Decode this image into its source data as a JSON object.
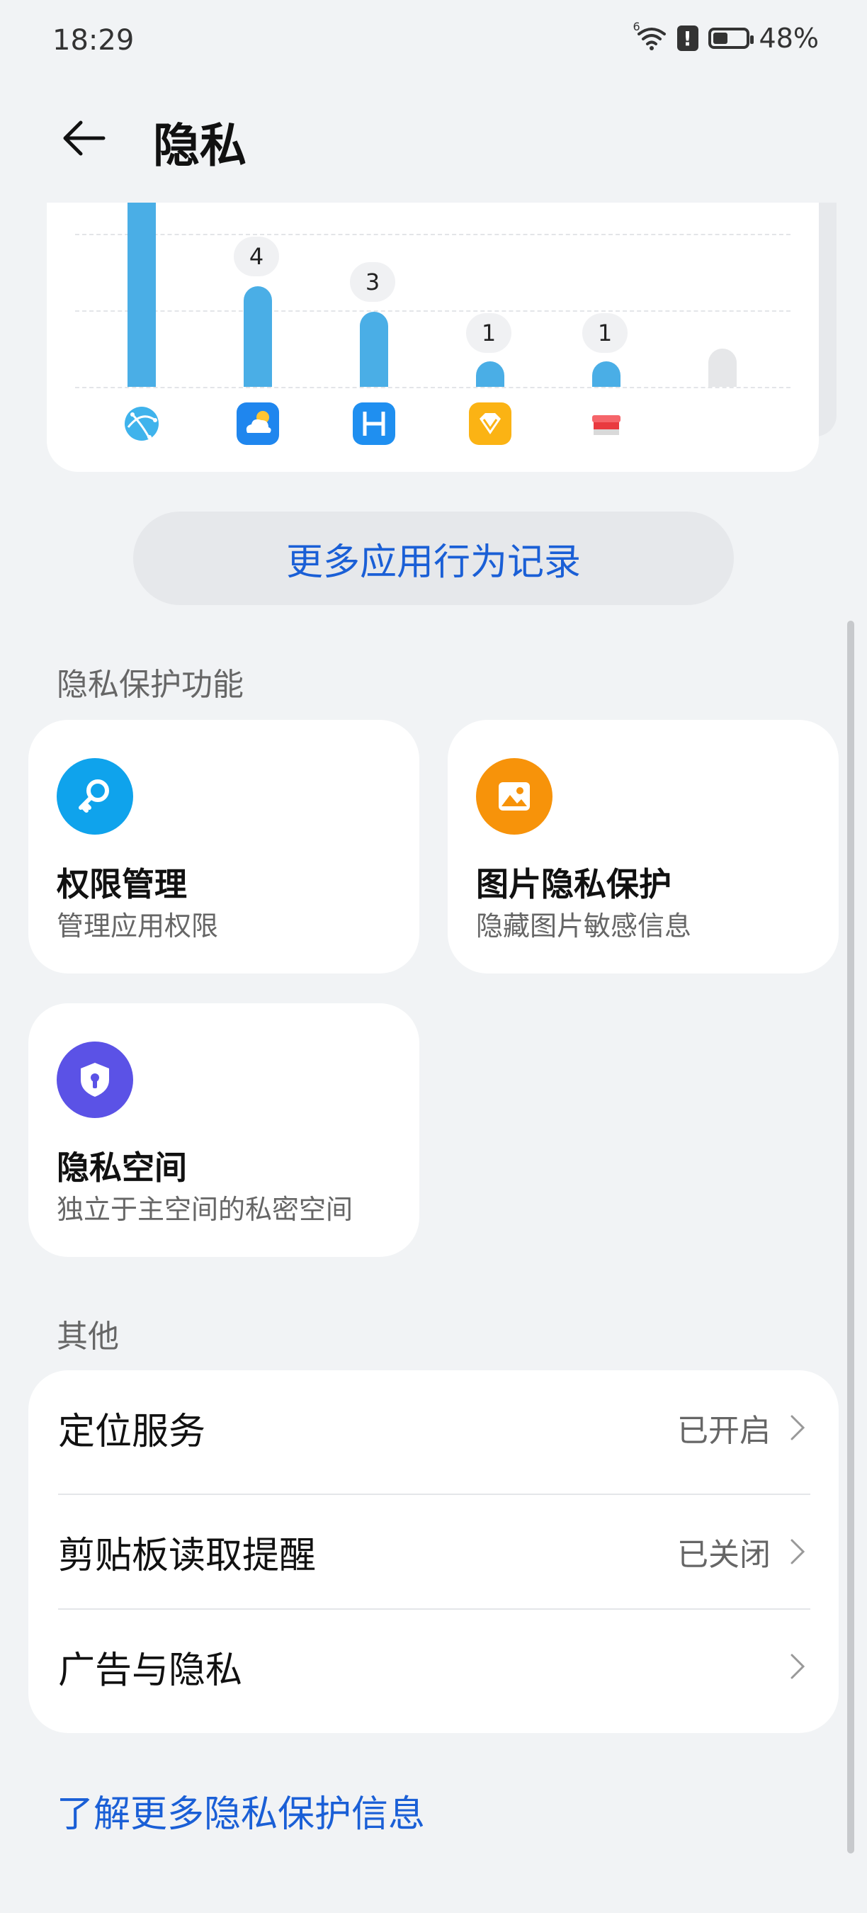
{
  "status_bar": {
    "time": "18:29",
    "battery": "48%",
    "signal_tag": "6"
  },
  "header": {
    "title": "隐私",
    "back_icon": "arrow-left-icon"
  },
  "chart_data": {
    "type": "bar",
    "categories": [
      "browser",
      "weather",
      "app-h",
      "diamond-app",
      "gift-app",
      "empty"
    ],
    "values": [
      null,
      4,
      3,
      1,
      1,
      0
    ],
    "labels": [
      "",
      "4",
      "3",
      "1",
      "1",
      ""
    ],
    "icons": [
      "globe-icon",
      "weather-icon",
      "h-app-icon",
      "diamond-icon",
      "gift-box-icon",
      ""
    ]
  },
  "more_button": {
    "label": "更多应用行为记录"
  },
  "privacy_section": {
    "label": "隐私保护功能",
    "cards": [
      {
        "title": "权限管理",
        "subtitle": "管理应用权限",
        "icon": "key-icon",
        "color": "#0fa3ec"
      },
      {
        "title": "图片隐私保护",
        "subtitle": "隐藏图片敏感信息",
        "icon": "image-icon",
        "color": "#f7930a"
      },
      {
        "title": "隐私空间",
        "subtitle": "独立于主空间的私密空间",
        "icon": "shield-lock-icon",
        "color": "#5b52e6"
      }
    ]
  },
  "other_section": {
    "label": "其他",
    "items": [
      {
        "label": "定位服务",
        "value": "已开启"
      },
      {
        "label": "剪贴板读取提醒",
        "value": "已关闭"
      },
      {
        "label": "广告与隐私",
        "value": ""
      }
    ]
  },
  "learn_more": {
    "label": "了解更多隐私保护信息"
  },
  "colors": {
    "accent": "#1a5fd6",
    "bar": "#4aaee6",
    "background": "#f1f3f5"
  }
}
